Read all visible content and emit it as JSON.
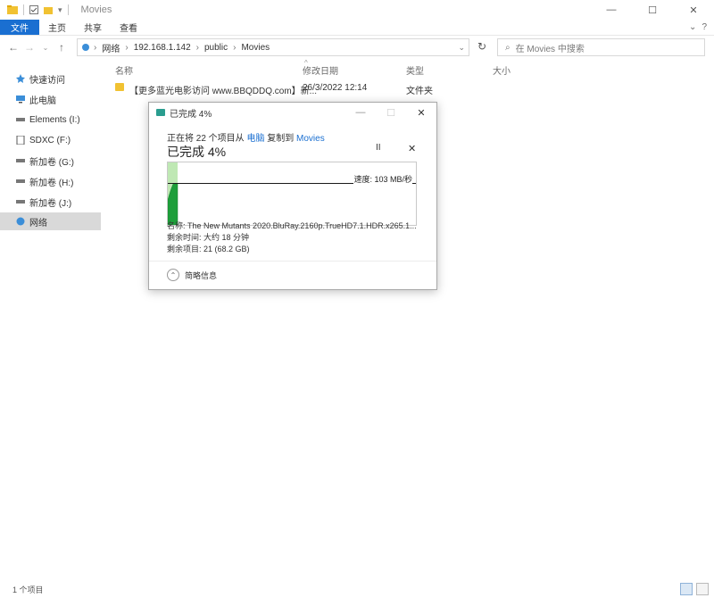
{
  "window": {
    "title": "Movies",
    "minimize": "—",
    "maximize": "☐",
    "close": "✕"
  },
  "ribbon": {
    "tabs": [
      "文件",
      "主页",
      "共享",
      "查看"
    ],
    "expand": "⌄",
    "help": "?"
  },
  "address": {
    "crumbs": [
      "网络",
      "192.168.1.142",
      "public",
      "Movies"
    ],
    "search_placeholder": "在 Movies 中搜索"
  },
  "sidebar": {
    "items": [
      {
        "label": "快速访问",
        "icon": "star-icon"
      },
      {
        "label": "此电脑",
        "icon": "pc-icon"
      },
      {
        "label": "Elements (I:)",
        "icon": "drive-icon"
      },
      {
        "label": "SDXC (F:)",
        "icon": "sd-icon"
      },
      {
        "label": "新加卷 (G:)",
        "icon": "drive-icon"
      },
      {
        "label": "新加卷 (H:)",
        "icon": "drive-icon"
      },
      {
        "label": "新加卷 (J:)",
        "icon": "drive-icon"
      },
      {
        "label": "网络",
        "icon": "network-icon"
      }
    ],
    "active_index": 7
  },
  "columns": {
    "name": "名称",
    "modified": "修改日期",
    "type": "类型",
    "size": "大小"
  },
  "files": [
    {
      "name": "【更多蓝光电影访问 www.BBQDDQ.com】新...",
      "modified": "26/3/2022 12:14",
      "type": "文件夹",
      "size": ""
    }
  ],
  "status": {
    "count": "1 个项目"
  },
  "copy_dialog": {
    "title": "已完成 4%",
    "line_prefix": "正在将 22 个项目从",
    "source": "电脑",
    "line_mid": "复制到",
    "dest": "Movies",
    "big_status": "已完成 4%",
    "pause": "II",
    "cancel": "✕",
    "speed": "速度: 103 MB/秒",
    "progress_fraction": 0.04,
    "name_label": "名称:",
    "name_value": "The New Mutants 2020.BluRay.2160p.TrueHD7.1.HDR.x265.1...",
    "time_label": "剩余时间:",
    "time_value": "大约 18 分钟",
    "items_label": "剩余项目:",
    "items_value": "21 (68.2 GB)",
    "details": "简略信息"
  }
}
